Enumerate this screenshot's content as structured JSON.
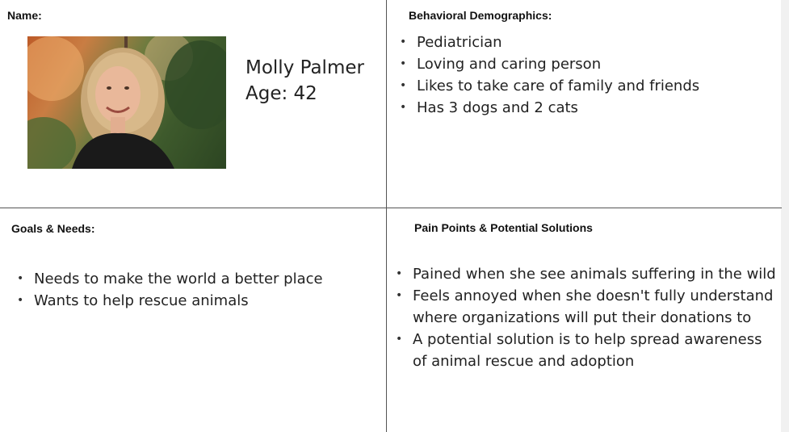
{
  "name_section": {
    "heading": "Name:",
    "person_name": "Molly Palmer",
    "age": "Age: 42"
  },
  "behavioral": {
    "heading": "Behavioral Demographics:",
    "items": [
      "Pediatrician",
      "Loving and caring person",
      "Likes to take care of family and friends",
      "Has 3 dogs and 2 cats"
    ]
  },
  "goals": {
    "heading": "Goals & Needs:",
    "items": [
      "Needs to make the world a better place",
      "Wants to help rescue animals"
    ]
  },
  "pain_points": {
    "heading": "Pain Points & Potential Solutions",
    "items": [
      "Pained when she see animals suffering in the wild",
      "Feels annoyed when she doesn't fully understand where organizations will put their donations to",
      "A potential solution is to help spread awareness of animal rescue and adoption"
    ]
  }
}
